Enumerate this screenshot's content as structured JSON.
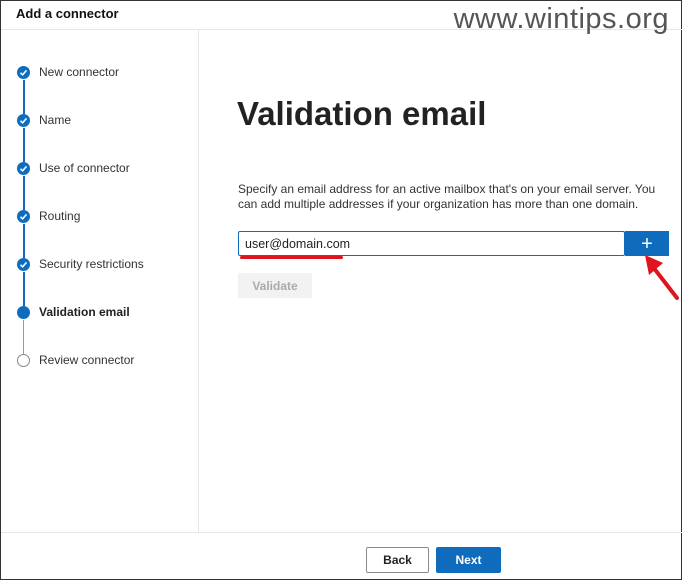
{
  "header": {
    "title": "Add a connector",
    "watermark": "www.wintips.org"
  },
  "steps": [
    {
      "label": "New connector",
      "state": "done"
    },
    {
      "label": "Name",
      "state": "done"
    },
    {
      "label": "Use of connector",
      "state": "done"
    },
    {
      "label": "Routing",
      "state": "done"
    },
    {
      "label": "Security restrictions",
      "state": "done"
    },
    {
      "label": "Validation email",
      "state": "current"
    },
    {
      "label": "Review connector",
      "state": "pending"
    }
  ],
  "main": {
    "title": "Validation email",
    "description": "Specify an email address for an active mailbox that's on your email server. You can add multiple addresses if your organization has more than one domain.",
    "email_value": "user@domain.com",
    "add_label": "+",
    "validate_label": "Validate"
  },
  "footer": {
    "back_label": "Back",
    "next_label": "Next"
  },
  "colors": {
    "accent": "#0f6cbd",
    "annotation": "#e0141e"
  }
}
